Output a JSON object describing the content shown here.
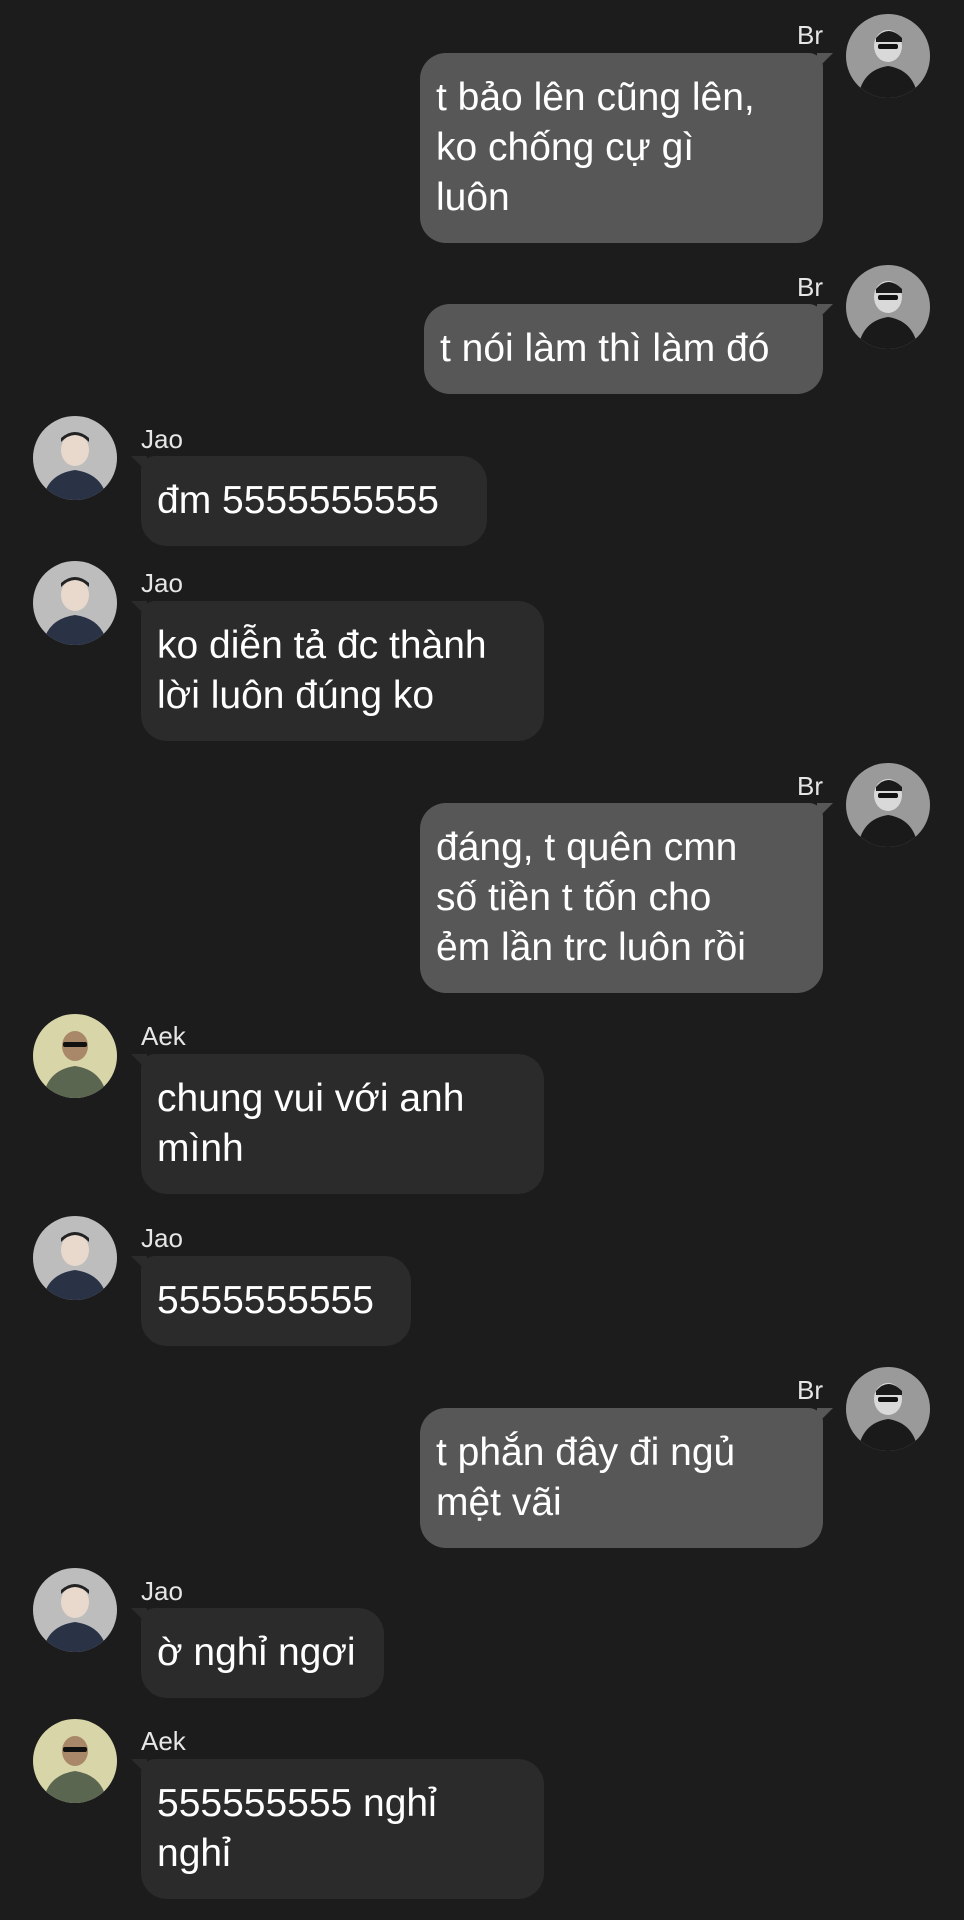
{
  "messages": [
    {
      "sender": "Br",
      "direction": "out",
      "text": "t bảo lên cũng lên,\nko chống cự gì\nluôn"
    },
    {
      "sender": "Br",
      "direction": "out",
      "text": "t nói làm thì làm đó"
    },
    {
      "sender": "Jao",
      "direction": "in",
      "text": "đm 5555555555"
    },
    {
      "sender": "Jao",
      "direction": "in",
      "text": "ko diễn tả đc thành\nlời luôn đúng ko"
    },
    {
      "sender": "Br",
      "direction": "out",
      "text": "đáng, t quên cmn\nsố tiền t tốn cho\nẻm lần trc luôn rồi"
    },
    {
      "sender": "Aek",
      "direction": "in",
      "text": "chung vui với anh\nmình"
    },
    {
      "sender": "Jao",
      "direction": "in",
      "text": "5555555555"
    },
    {
      "sender": "Br",
      "direction": "out",
      "text": "t phắn đây đi ngủ\nmệt vãi"
    },
    {
      "sender": "Jao",
      "direction": "in",
      "text": "ờ nghỉ ngơi"
    },
    {
      "sender": "Aek",
      "direction": "in",
      "text": "555555555 nghỉ\nnghỉ"
    }
  ],
  "colors": {
    "background": "#1c1c1c",
    "incoming_bubble": "#2b2b2b",
    "outgoing_bubble": "#575757",
    "text": "#ffffff"
  }
}
